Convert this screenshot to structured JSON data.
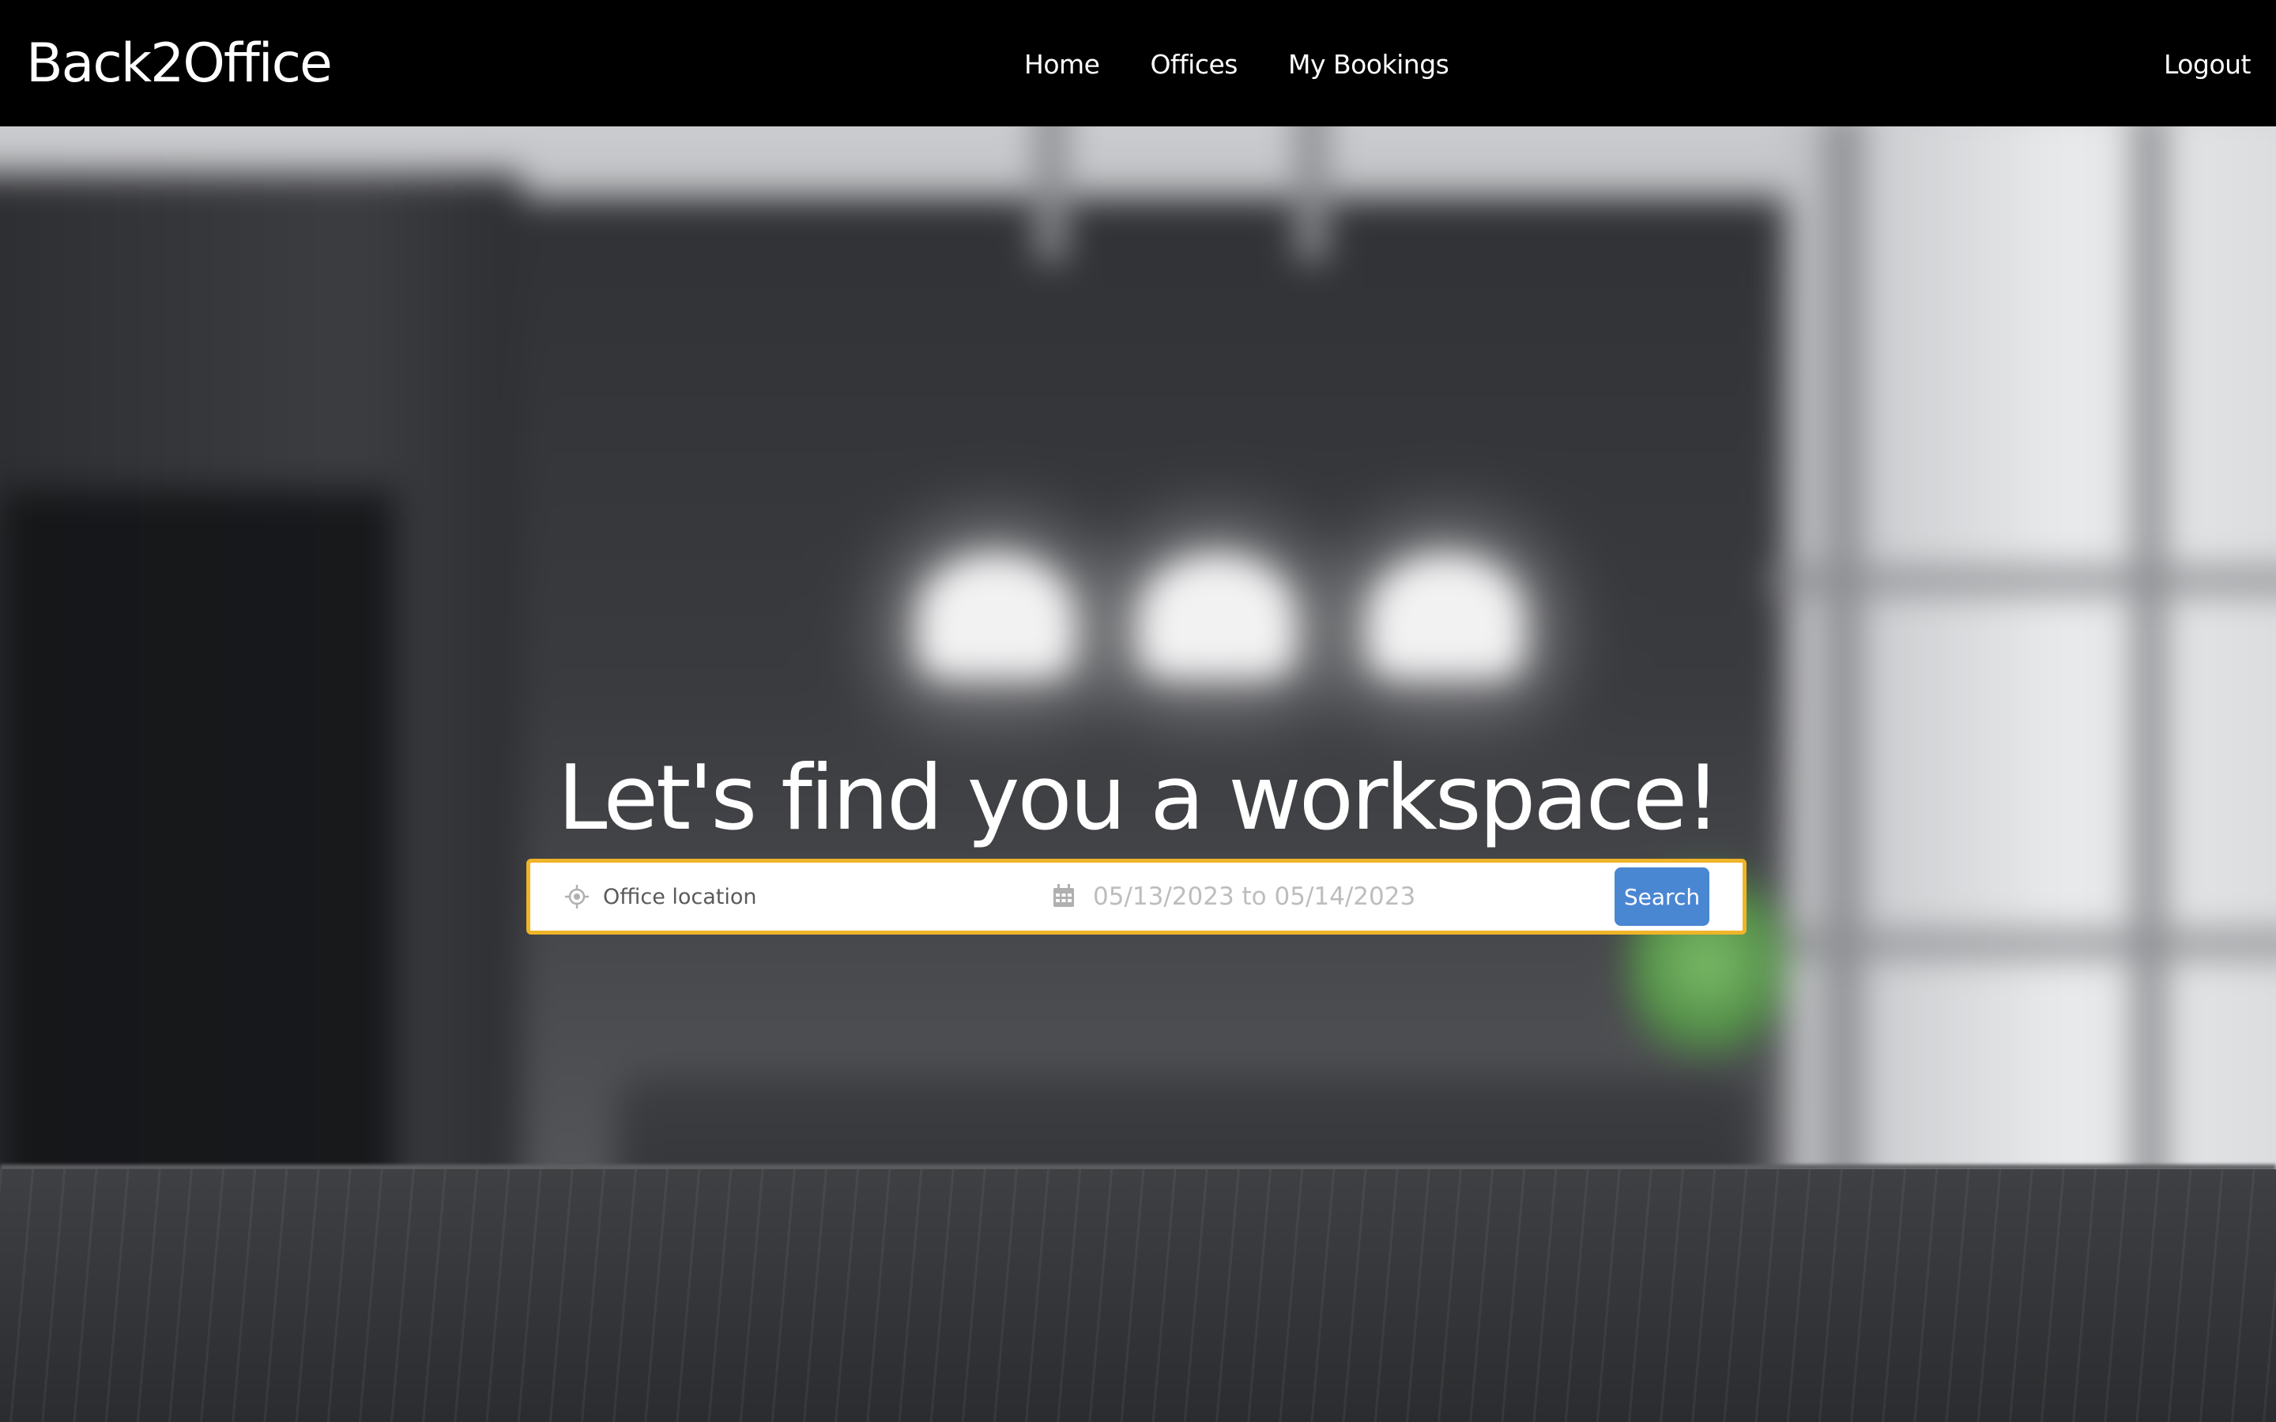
{
  "navbar": {
    "brand": "Back2Office",
    "links": [
      "Home",
      "Offices",
      "My Bookings"
    ],
    "logout": "Logout"
  },
  "hero": {
    "headline": "Let's find you a workspace!"
  },
  "search": {
    "location_placeholder": "Office location",
    "date_placeholder": "05/13/2023 to 05/14/2023",
    "button_label": "Search",
    "location_icon": "crosshair-icon",
    "date_icon": "calendar-icon"
  },
  "colors": {
    "navbar_bg": "#000000",
    "search_border": "#f0b429",
    "button_bg": "#4a87d3"
  }
}
